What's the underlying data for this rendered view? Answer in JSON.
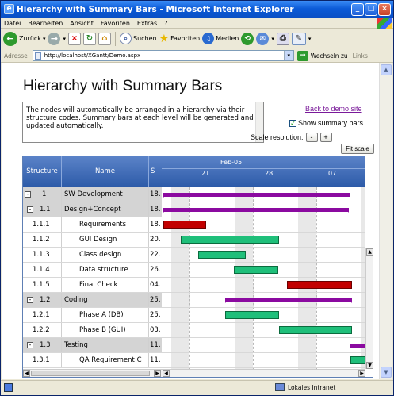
{
  "window": {
    "title": "Hierarchy with Summary Bars - Microsoft Internet Explorer",
    "min": "_",
    "max": "□",
    "close": "×"
  },
  "menu": [
    "Datei",
    "Bearbeiten",
    "Ansicht",
    "Favoriten",
    "Extras",
    "?"
  ],
  "toolbar": {
    "back": "Zurück",
    "search": "Suchen",
    "favorites": "Favoriten",
    "media": "Medien"
  },
  "address": {
    "label": "Adresse",
    "url": "http://localhost/XGantt/Demo.aspx",
    "go": "Wechseln zu",
    "links": "Links"
  },
  "page": {
    "title": "Hierarchy with Summary Bars",
    "description": "The nodes will automatically be arranged in a hierarchy via their structure codes. Summary bars at each level will be generated and updated automatically.",
    "back_link": "Back to demo site",
    "show_summary": "Show summary bars",
    "show_summary_checked": true,
    "scale_resolution": "Scale resolution:",
    "minus": "-",
    "plus": "+",
    "fit_scale": "Fit scale"
  },
  "grid": {
    "columns": [
      "Structure",
      "Name",
      "S"
    ],
    "rows": [
      {
        "structure": "1",
        "name": "SW Development",
        "start": "18.",
        "kind": "summary",
        "expander": "-"
      },
      {
        "structure": "1.1",
        "name": "Design+Concept",
        "start": "18.",
        "kind": "summary",
        "expander": "-"
      },
      {
        "structure": "1.1.1",
        "name": "Requirements",
        "start": "18.",
        "kind": "leaf"
      },
      {
        "structure": "1.1.2",
        "name": "GUI Design",
        "start": "20.",
        "kind": "leaf"
      },
      {
        "structure": "1.1.3",
        "name": "Class design",
        "start": "22.",
        "kind": "leaf"
      },
      {
        "structure": "1.1.4",
        "name": "Data structure",
        "start": "26.",
        "kind": "leaf"
      },
      {
        "structure": "1.1.5",
        "name": "Final Check",
        "start": "04.",
        "kind": "leaf"
      },
      {
        "structure": "1.2",
        "name": "Coding",
        "start": "25.",
        "kind": "summary",
        "expander": "-"
      },
      {
        "structure": "1.2.1",
        "name": "Phase A (DB)",
        "start": "25.",
        "kind": "leaf"
      },
      {
        "structure": "1.2.2",
        "name": "Phase B (GUI)",
        "start": "03.",
        "kind": "leaf"
      },
      {
        "structure": "1.3",
        "name": "Testing",
        "start": "11.",
        "kind": "summary",
        "expander": "-"
      },
      {
        "structure": "1.3.1",
        "name": "QA Requirement C",
        "start": "11.",
        "kind": "leaf"
      }
    ]
  },
  "timeline": {
    "month": "Feb-05",
    "days": [
      "21",
      "28",
      "07"
    ]
  },
  "status": {
    "zone": "Lokales Intranet"
  },
  "colors": {
    "summary_bar": "#8b0aa0",
    "task_green": "#1fbf7a",
    "task_red": "#c20000",
    "header_blue": "#2c5aa8"
  }
}
